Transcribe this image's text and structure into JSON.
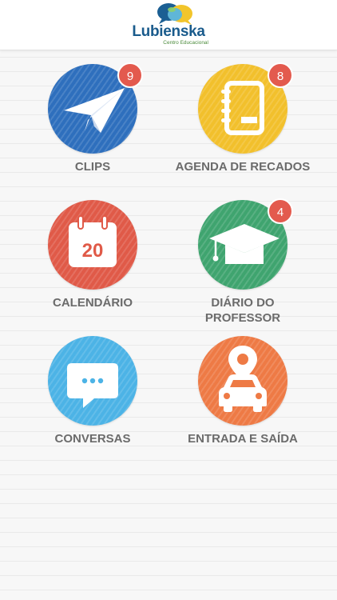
{
  "header": {
    "logo_name": "Lubienska",
    "logo_subtitle": "Centro Educacional",
    "logo_icon": "speech-bubbles-logo"
  },
  "menu": [
    {
      "id": "clips",
      "label": "CLIPS",
      "badge": "9",
      "icon": "paper-plane-icon",
      "color": "#2e6fbd"
    },
    {
      "id": "agenda",
      "label": "AGENDA DE RECADOS",
      "badge": "8",
      "icon": "notebook-icon",
      "color": "#f2c02c"
    },
    {
      "id": "calendario",
      "label": "CALENDÁRIO",
      "badge": null,
      "icon": "calendar-icon",
      "calendar_day": "20",
      "color": "#e05a48"
    },
    {
      "id": "diario",
      "label_line1": "DIÁRIO DO",
      "label_line2": "PROFESSOR",
      "badge": "4",
      "icon": "graduation-cap-icon",
      "color": "#3fa46f"
    },
    {
      "id": "conversas",
      "label": "CONVERSAS",
      "badge": null,
      "icon": "chat-bubble-icon",
      "color": "#4cb3e6"
    },
    {
      "id": "entrada",
      "label": "ENTRADA E SAÍDA",
      "badge": null,
      "icon": "car-location-icon",
      "color": "#ee7a45"
    }
  ],
  "colors": {
    "badge": "#e35a4e",
    "label_text": "#6b6b6b",
    "brand_blue": "#1a5b8c"
  }
}
